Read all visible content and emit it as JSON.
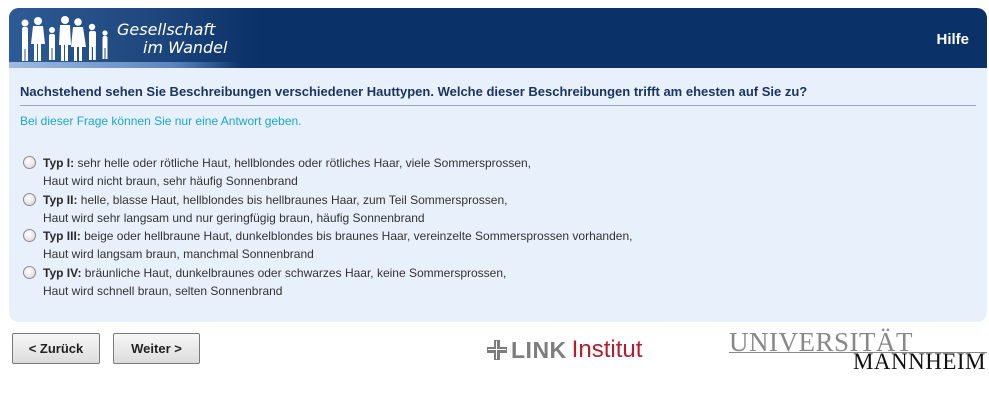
{
  "header": {
    "brand_line1": "Gesellschaft",
    "brand_line2": "im Wandel",
    "help_label": "Hilfe"
  },
  "question": {
    "text": "Nachstehend sehen Sie Beschreibungen verschiedener Hauttypen. Welche dieser Beschreibungen trifft am ehesten auf Sie zu?",
    "hint": "Bei dieser Frage können Sie nur eine Antwort geben."
  },
  "options": [
    {
      "title": "Typ I:",
      "line1": " sehr helle oder rötliche Haut, hellblondes oder rötliches Haar, viele Sommersprossen,",
      "line2": "Haut wird nicht braun, sehr häufig Sonnenbrand",
      "selected": false
    },
    {
      "title": "Typ II:",
      "line1": " helle, blasse Haut, hellblondes bis hellbraunes Haar, zum Teil Sommersprossen,",
      "line2": "Haut wird sehr langsam und nur geringfügig braun, häufig Sonnenbrand",
      "selected": false
    },
    {
      "title": "Typ III:",
      "line1": " beige oder hellbraune Haut, dunkelblondes bis braunes Haar, vereinzelte Sommersprossen vorhanden,",
      "line2": "Haut wird langsam braun, manchmal Sonnenbrand",
      "selected": false
    },
    {
      "title": "Typ IV:",
      "line1": " bräunliche Haut, dunkelbraunes oder schwarzes Haar, keine Sommersprossen,",
      "line2": "Haut wird schnell braun, selten Sonnenbrand",
      "selected": false
    }
  ],
  "nav": {
    "back_label": "< Zurück",
    "next_label": "Weiter >"
  },
  "logos": {
    "link_word": "LINK",
    "institut_word": "Institut",
    "uni_line1": "UNIVERSITÄT",
    "uni_line2": "MANNHEIM"
  },
  "colors": {
    "header_bg": "#0b3268",
    "panel_bg": "#e8f0fb",
    "question_text": "#1b3561",
    "hint_text": "#1aa7c9",
    "institut_red": "#b51c2e"
  }
}
